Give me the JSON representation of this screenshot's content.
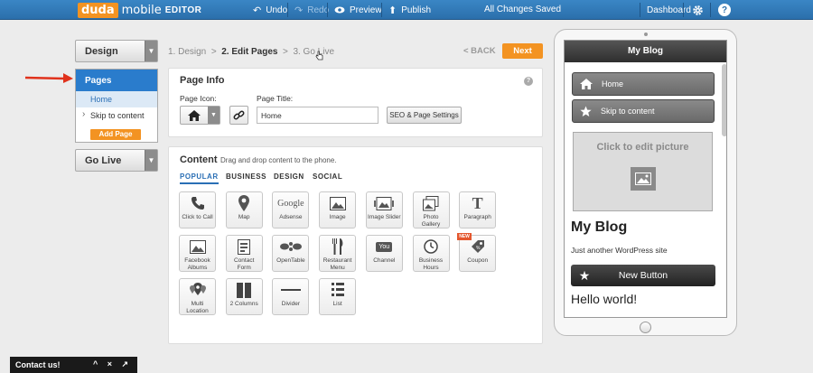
{
  "topbar": {
    "logo": {
      "duda": "duda",
      "mobile": "mobile",
      "editor": "EDITOR"
    },
    "undo": "Undo",
    "redo": "Redo",
    "preview": "Preview",
    "publish": "Publish",
    "status": "All Changes Saved",
    "dashboard": "Dashboard",
    "help": "?"
  },
  "sidebar": {
    "design": "Design",
    "pages_header": "Pages",
    "pages": [
      "Home",
      "Skip to content"
    ],
    "add_page": "Add Page",
    "go_live": "Go Live"
  },
  "steps": {
    "step1": "1. Design",
    "sep": ">",
    "step2": "2. Edit Pages",
    "step3": "3. Go Live",
    "back": "< BACK",
    "next": "Next"
  },
  "page_info": {
    "title": "Page Info",
    "icon_label": "Page Icon:",
    "title_label": "Page Title:",
    "title_value": "Home",
    "seo_button": "SEO & Page Settings",
    "help": "?"
  },
  "content": {
    "title": "Content",
    "subtitle": "Drag and drop content to the phone.",
    "tabs": [
      "POPULAR",
      "BUSINESS",
      "DESIGN",
      "SOCIAL"
    ],
    "widgets": [
      {
        "label": "Click to Call",
        "icon": "phone-icon"
      },
      {
        "label": "Map",
        "icon": "map-pin-icon"
      },
      {
        "label": "Adsense",
        "icon": "google-icon",
        "icon_text": "Google"
      },
      {
        "label": "Image",
        "icon": "image-icon"
      },
      {
        "label": "Image Slider",
        "icon": "image-slider-icon"
      },
      {
        "label": "Photo Gallery",
        "icon": "photo-gallery-icon"
      },
      {
        "label": "Paragraph",
        "icon": "paragraph-icon",
        "icon_text": "T"
      },
      {
        "label": "Facebook Albums",
        "icon": "facebook-albums-icon"
      },
      {
        "label": "Contact Form",
        "icon": "contact-form-icon"
      },
      {
        "label": "OpenTable",
        "icon": "opentable-icon"
      },
      {
        "label": "Restaurant Menu",
        "icon": "restaurant-menu-icon"
      },
      {
        "label": "Channel",
        "icon": "youtube-channel-icon",
        "icon_text": "You"
      },
      {
        "label": "Business Hours",
        "icon": "clock-icon"
      },
      {
        "label": "Coupon",
        "icon": "coupon-icon",
        "badge": "NEW"
      },
      {
        "label": "Multi Location",
        "icon": "multi-location-icon"
      },
      {
        "label": "2 Columns",
        "icon": "two-columns-icon"
      },
      {
        "label": "Divider",
        "icon": "divider-icon"
      },
      {
        "label": "List",
        "icon": "list-icon"
      }
    ]
  },
  "phone": {
    "header": "My Blog",
    "nav": [
      "Home",
      "Skip to content"
    ],
    "picture_text": "Click to edit picture",
    "blog_title": "My Blog",
    "tagline": "Just another WordPress site",
    "button": "New Button",
    "post_title": "Hello world!"
  },
  "contact": {
    "label": "Contact us!",
    "controls": "^ × ↗"
  },
  "colors": {
    "topbar": "#2b6fab",
    "accent": "#f39322",
    "selected": "#2a7ccc",
    "annotation_arrow": "#e0321c"
  }
}
